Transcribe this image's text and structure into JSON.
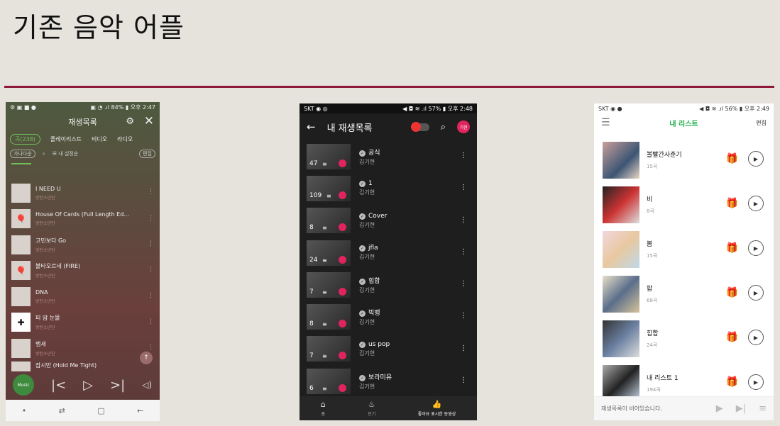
{
  "slide": {
    "title": "기존 음악 어플"
  },
  "phone1": {
    "status_left": "⚙ ▣ ■ ●",
    "status_right": "▣ ◔ .ıl 84% ▮ 오후 2:47",
    "title": "재생목록",
    "tabs": [
      "곡(238)",
      "플레이리스트",
      "비디오",
      "라디오"
    ],
    "tools": {
      "filter": "가나다순",
      "my_settings": "☰ 내 설정순",
      "edit": "편집"
    },
    "rows": [
      {
        "title": "I NEED U",
        "artist": "방탄소년단"
      },
      {
        "title": "House Of Cards (Full Length Ed...",
        "artist": "방탄소년단"
      },
      {
        "title": "고민보다 Go",
        "artist": "방탄소년단"
      },
      {
        "title": "불타오르네 (FIRE)",
        "artist": "방탄소년단"
      },
      {
        "title": "DNA",
        "artist": "방탄소년단"
      },
      {
        "title": "피 땀 눈물",
        "artist": "방탄소년단"
      },
      {
        "title": "뱁새",
        "artist": "방탄소년단"
      },
      {
        "title": "잠시만 (Hold Me Tight)",
        "artist": ""
      }
    ],
    "player_label": "Music"
  },
  "phone2": {
    "status_left": "SKT ◉ ◎",
    "status_right": "◀ ◘ ≋ .ıl 57% ▮ 오후 2:48",
    "title": "내 재생목록",
    "avatar": "기현",
    "rows": [
      {
        "count": "47",
        "name": "공식",
        "owner": "김기현"
      },
      {
        "count": "109",
        "name": "1",
        "owner": "김기현"
      },
      {
        "count": "8",
        "name": "Cover",
        "owner": "김기현"
      },
      {
        "count": "24",
        "name": "jfla",
        "owner": "김기현"
      },
      {
        "count": "7",
        "name": "힙합",
        "owner": "김기현"
      },
      {
        "count": "8",
        "name": "빅뱅",
        "owner": "김기현"
      },
      {
        "count": "7",
        "name": "us pop",
        "owner": "김기현"
      },
      {
        "count": "6",
        "name": "보라미유",
        "owner": "김기현"
      }
    ],
    "nav": [
      {
        "label": "홈"
      },
      {
        "label": "인기"
      },
      {
        "label": "좋아요 표시한 동영상"
      }
    ]
  },
  "phone3": {
    "status_left": "SKT ◉ ●",
    "status_right": "◀ ◘ ≋ .ıl 56% ▮ 오후 2:49",
    "title": "내 리스트",
    "edit": "편집",
    "rows": [
      {
        "name": "볼빨간사춘기",
        "count": "15곡"
      },
      {
        "name": "비",
        "count": "8곡"
      },
      {
        "name": "봄",
        "count": "15곡"
      },
      {
        "name": "팝",
        "count": "68곡"
      },
      {
        "name": "힙합",
        "count": "24곡"
      },
      {
        "name": "내 리스트 1",
        "count": "194곡"
      }
    ],
    "empty_message": "재생목록이 비어있습니다."
  }
}
